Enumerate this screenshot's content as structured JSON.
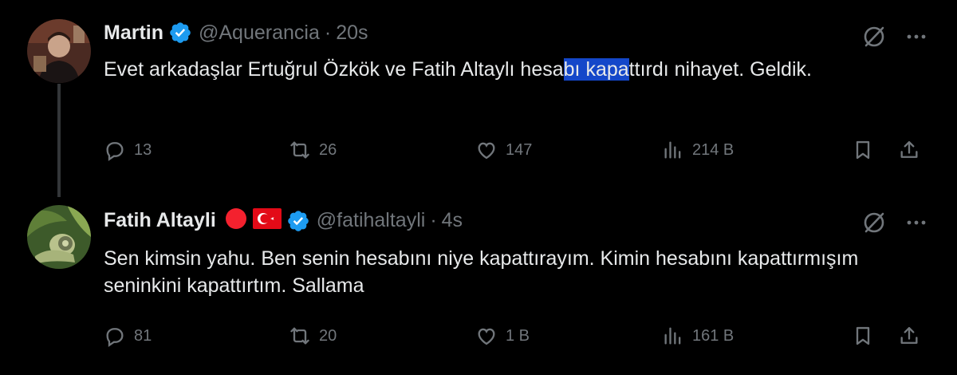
{
  "tweets": [
    {
      "name": "Martin",
      "handle": "@Aquerancia",
      "separator": "·",
      "time": "20s",
      "text_before": "Evet arkadaşlar Ertuğrul Özkök ve Fatih Altaylı hesa",
      "text_highlight": "bı kapa",
      "text_after": "ttırdı nihayet. Geldik.",
      "replies": "13",
      "reposts": "26",
      "likes": "147",
      "views": "214 B"
    },
    {
      "name": "Fatih Altayli",
      "handle": "@fatihaltayli",
      "separator": "·",
      "time": "4s",
      "text": "Sen kimsin yahu. Ben senin hesabını niye kapattırayım. Kimin hesabını kapattırmışım seninkini kapattırtım. Sallama",
      "replies": "81",
      "reposts": "20",
      "likes": "1 B",
      "views": "161 B"
    }
  ],
  "colors": {
    "background": "#000000",
    "text_primary": "#e7e9ea",
    "text_secondary": "#71767b",
    "verified_blue": "#1d9bf0",
    "selection": "#1447c9",
    "red_circle": "#f4212e",
    "flag_red": "#e30a17"
  },
  "icons": {
    "verified": "verified-badge-icon",
    "grok": "grok-icon",
    "more": "more-icon",
    "reply": "reply-icon",
    "repost": "repost-icon",
    "like": "like-icon",
    "views": "views-icon",
    "bookmark": "bookmark-icon",
    "share": "share-icon"
  }
}
